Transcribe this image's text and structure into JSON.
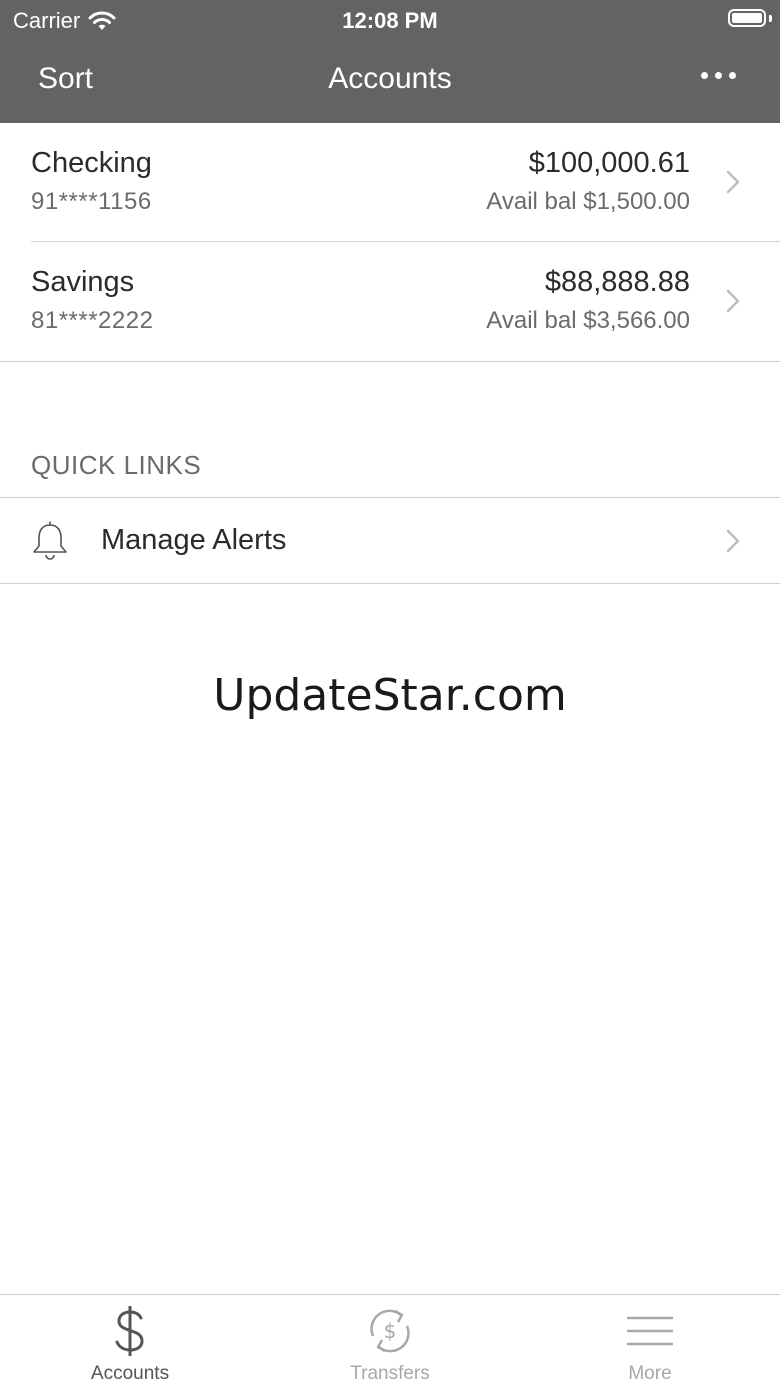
{
  "status_bar": {
    "carrier": "Carrier",
    "time": "12:08 PM"
  },
  "nav": {
    "left_label": "Sort",
    "title": "Accounts",
    "right_icon": "more-dots-icon"
  },
  "accounts": [
    {
      "name": "Checking",
      "number": "91****1156",
      "balance": "$100,000.61",
      "available": "Avail bal $1,500.00"
    },
    {
      "name": "Savings",
      "number": "81****2222",
      "balance": "$88,888.88",
      "available": "Avail bal $3,566.00"
    }
  ],
  "quick_links": {
    "header": "QUICK LINKS",
    "items": [
      {
        "label": "Manage Alerts",
        "icon": "bell-icon"
      }
    ]
  },
  "watermark": "UpdateStar.com",
  "tabbar": {
    "tabs": [
      {
        "label": "Accounts",
        "icon": "dollar-icon",
        "active": true
      },
      {
        "label": "Transfers",
        "icon": "transfer-dollar-icon",
        "active": false
      },
      {
        "label": "More",
        "icon": "menu-lines-icon",
        "active": false
      }
    ]
  },
  "colors": {
    "header_bg": "#636363",
    "header_text": "#ffffff",
    "primary_text": "#2b2b2b",
    "secondary_text": "#6b6b6b",
    "divider": "#d4d4d4",
    "inactive_tab": "#a8a8a8"
  }
}
